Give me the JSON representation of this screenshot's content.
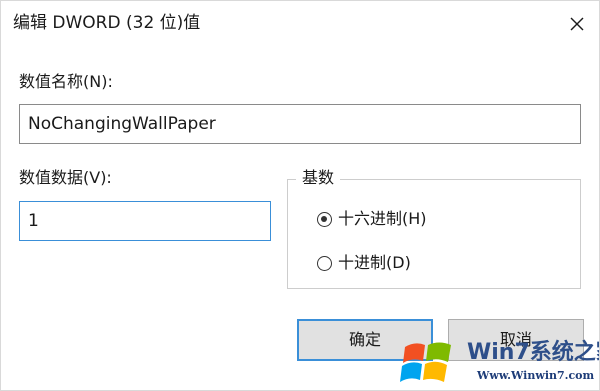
{
  "window": {
    "title": "编辑 DWORD (32 位)值",
    "close_icon": "close-icon"
  },
  "value_name": {
    "label": "数值名称(N):",
    "value": "NoChangingWallPaper"
  },
  "value_data": {
    "label": "数值数据(V):",
    "value": "1"
  },
  "base": {
    "title": "基数",
    "options": [
      {
        "label": "十六进制(H)",
        "selected": true
      },
      {
        "label": "十进制(D)",
        "selected": false
      }
    ]
  },
  "buttons": {
    "ok_label": "确定",
    "cancel_label": "取消"
  },
  "watermark": {
    "brand": "Win7系统之家",
    "url": "Www.Winwin7.com",
    "logo_icon": "windows-logo-icon"
  },
  "colors": {
    "focus_border": "#3a8fd8",
    "button_face": "#e1e1e1"
  }
}
